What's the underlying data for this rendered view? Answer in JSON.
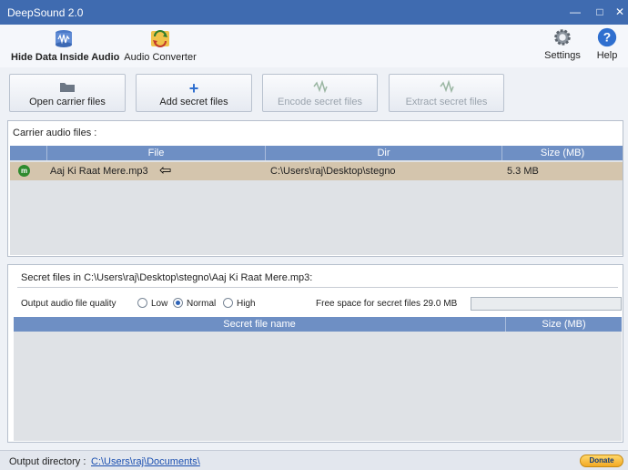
{
  "window": {
    "title": "DeepSound 2.0",
    "controls": [
      "minimize",
      "maximize",
      "close"
    ]
  },
  "ribbon": {
    "hide_data": {
      "label": "Hide Data Inside Audio",
      "icon": "database-audio-icon"
    },
    "audio_converter": {
      "label": "Audio Converter",
      "icon": "convert-icon"
    },
    "settings": {
      "label": "Settings",
      "icon": "gear-icon"
    },
    "help": {
      "label": "Help",
      "icon": "help-icon"
    }
  },
  "actions": {
    "open_carrier": {
      "label": "Open carrier files",
      "enabled": true,
      "icon": "folder-icon"
    },
    "add_secret": {
      "label": "Add secret files",
      "enabled": true,
      "icon": "plus-icon"
    },
    "encode_secret": {
      "label": "Encode secret files",
      "enabled": false,
      "icon": "encode-icon"
    },
    "extract_secret": {
      "label": "Extract secret files",
      "enabled": false,
      "icon": "extract-icon"
    }
  },
  "carrier": {
    "label": "Carrier audio files :",
    "columns": {
      "file": "File",
      "dir": "Dir",
      "size": "Size (MB)"
    },
    "rows": [
      {
        "status": "m",
        "file": "Aaj Ki Raat Mere.mp3",
        "dir": "C:\\Users\\raj\\Desktop\\stegno",
        "size": "5.3 MB"
      }
    ]
  },
  "secret": {
    "title": "Secret files in C:\\Users\\raj\\Desktop\\stegno\\Aaj Ki Raat Mere.mp3:",
    "quality_label": "Output audio file quality",
    "quality_options": [
      "Low",
      "Normal",
      "High"
    ],
    "quality_selected": "Normal",
    "free_space_label": "Free space for secret files :",
    "free_space_value": "29.0 MB",
    "usage_fraction": 0.0,
    "columns": {
      "name": "Secret file name",
      "size": "Size (MB)"
    }
  },
  "statusbar": {
    "output_label": "Output directory :",
    "output_path": "C:\\Users\\raj\\Documents\\",
    "donate_label": "Donate"
  },
  "colors": {
    "titlebar": "#3f6bb0",
    "grid_header": "#6e8fc4",
    "selected_row": "#d4c5ad",
    "status_ok": "#2e8b2e"
  }
}
